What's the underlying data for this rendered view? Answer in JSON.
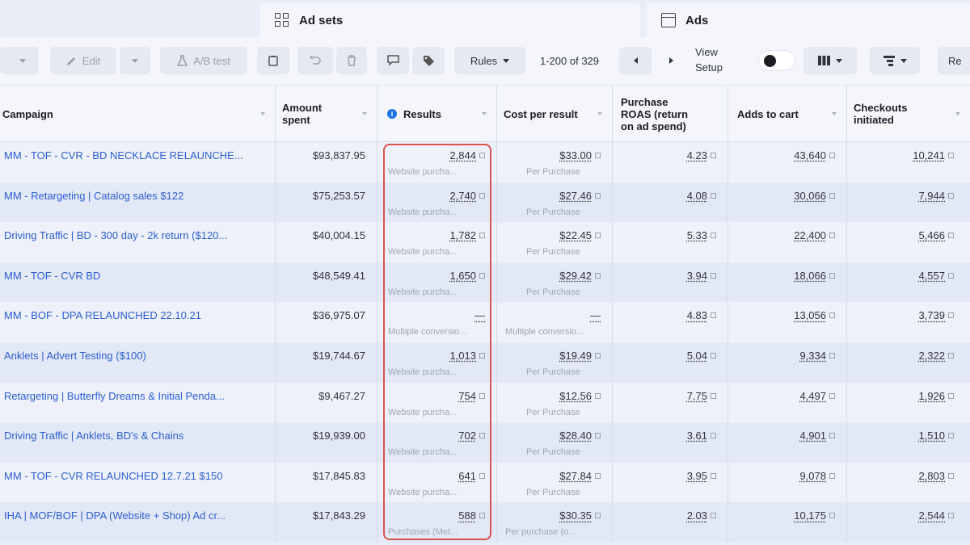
{
  "tabs": {
    "adsets": {
      "label": "Ad sets",
      "icon": "grid-icon"
    },
    "ads": {
      "label": "Ads",
      "icon": "square-icon"
    }
  },
  "toolbar": {
    "edit_label": "Edit",
    "ab_test_label": "A/B test",
    "rules_label": "Rules",
    "pagination": "1-200 of 329",
    "view_setup_line1": "View",
    "view_setup_line2": "Setup",
    "reports_label": "Re"
  },
  "columns": {
    "campaign": "Campaign",
    "amount_spent_1": "Amount",
    "amount_spent_2": "spent",
    "results": "Results",
    "cost_per_result": "Cost per result",
    "roas_1": "Purchase",
    "roas_2": "ROAS (return",
    "roas_3": "on ad spend)",
    "adds_to_cart": "Adds to cart",
    "checkouts_1": "Checkouts",
    "checkouts_2": "initiated"
  },
  "rows": [
    {
      "campaign": "MM - TOF - CVR - BD NECKLACE RELAUNCHE...",
      "spent": "$93,837.95",
      "results": "2,844",
      "results_sub": "Website purcha...",
      "cost": "$33.00",
      "cost_sub": "Per Purchase",
      "roas": "4.23",
      "carts": "43,640",
      "checkouts": "10,241"
    },
    {
      "campaign": "MM - Retargeting | Catalog sales $122",
      "spent": "$75,253.57",
      "results": "2,740",
      "results_sub": "Website purcha...",
      "cost": "$27.46",
      "cost_sub": "Per Purchase",
      "roas": "4.08",
      "carts": "30,066",
      "checkouts": "7,944"
    },
    {
      "campaign": "Driving Traffic | BD - 300 day - 2k return ($120...",
      "spent": "$40,004.15",
      "results": "1,782",
      "results_sub": "Website purcha...",
      "cost": "$22.45",
      "cost_sub": "Per Purchase",
      "roas": "5.33",
      "carts": "22,400",
      "checkouts": "5,466"
    },
    {
      "campaign": "MM - TOF - CVR BD",
      "spent": "$48,549.41",
      "results": "1,650",
      "results_sub": "Website purcha...",
      "cost": "$29.42",
      "cost_sub": "Per Purchase",
      "roas": "3.94",
      "carts": "18,066",
      "checkouts": "4,557"
    },
    {
      "campaign": "MM - BOF - DPA RELAUNCHED 22.10.21",
      "spent": "$36,975.07",
      "results": "—",
      "results_sub": "Multiple conversio...",
      "cost": "—",
      "cost_sub": "Multiple conversio...",
      "roas": "4.83",
      "carts": "13,056",
      "checkouts": "3,739"
    },
    {
      "campaign": "Anklets | Advert Testing ($100)",
      "spent": "$19,744.67",
      "results": "1,013",
      "results_sub": "Website purcha...",
      "cost": "$19.49",
      "cost_sub": "Per Purchase",
      "roas": "5.04",
      "carts": "9,334",
      "checkouts": "2,322"
    },
    {
      "campaign": "Retargeting | Butterfly Dreams & Initial Penda...",
      "spent": "$9,467.27",
      "results": "754",
      "results_sub": "Website purcha...",
      "cost": "$12.56",
      "cost_sub": "Per Purchase",
      "roas": "7.75",
      "carts": "4,497",
      "checkouts": "1,926"
    },
    {
      "campaign": "Driving Traffic | Anklets, BD's & Chains",
      "spent": "$19,939.00",
      "results": "702",
      "results_sub": "Website purcha...",
      "cost": "$28.40",
      "cost_sub": "Per Purchase",
      "roas": "3.61",
      "carts": "4,901",
      "checkouts": "1,510"
    },
    {
      "campaign": "MM - TOF - CVR RELAUNCHED 12.7.21 $150",
      "spent": "$17,845.83",
      "results": "641",
      "results_sub": "Website purcha...",
      "cost": "$27.84",
      "cost_sub": "Per Purchase",
      "roas": "3.95",
      "carts": "9,078",
      "checkouts": "2,803"
    },
    {
      "campaign": "IHA | MOF/BOF | DPA (Website + Shop) Ad cr...",
      "spent": "$17,843.29",
      "results": "588",
      "results_sub": "Purchases (Met...",
      "cost": "$30.35",
      "cost_sub": "Per purchase (o...",
      "roas": "2.03",
      "carts": "10,175",
      "checkouts": "2,544"
    }
  ],
  "colors": {
    "link": "#2b5fd0",
    "highlight": "#d9534f",
    "info": "#1b74e4"
  }
}
